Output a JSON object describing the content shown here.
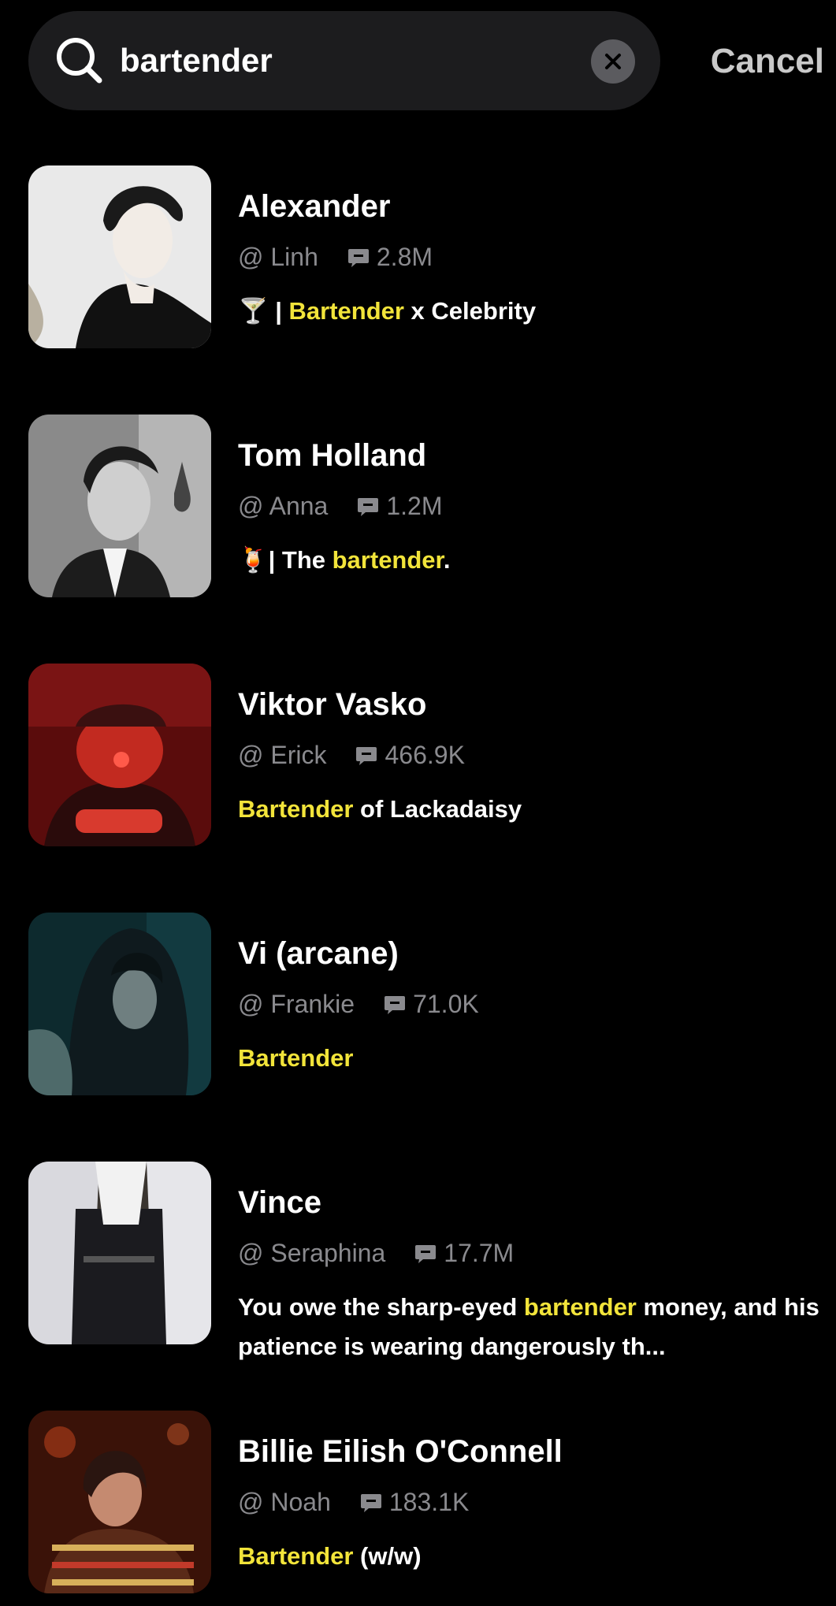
{
  "search": {
    "value": "bartender",
    "cancel_label": "Cancel"
  },
  "results": [
    {
      "name": "Alexander",
      "creator": "@ Linh",
      "count": "2.8M",
      "desc_pre": "🍸 | ",
      "desc_hl": "Bartender",
      "desc_post": " x Celebrity"
    },
    {
      "name": "Tom Holland",
      "creator": "@ Anna",
      "count": "1.2M",
      "desc_pre": "🍹| The ",
      "desc_hl": "bartender",
      "desc_post": "."
    },
    {
      "name": "Viktor Vasko",
      "creator": "@ Erick",
      "count": "466.9K",
      "desc_pre": "",
      "desc_hl": "Bartender",
      "desc_post": " of Lackadaisy"
    },
    {
      "name": "Vi (arcane)",
      "creator": "@ Frankie",
      "count": "71.0K",
      "desc_pre": " ",
      "desc_hl": "Bartender",
      "desc_post": ""
    },
    {
      "name": "Vince",
      "creator": "@ Seraphina",
      "count": "17.7M",
      "desc_pre": "You owe the sharp-eyed ",
      "desc_hl": "bartender",
      "desc_post": " money, and his patience is wearing dangerously th..."
    },
    {
      "name": "Billie Eilish O'Connell",
      "creator": "@ Noah",
      "count": "183.1K",
      "desc_pre": "",
      "desc_hl": "Bartender",
      "desc_post": " (w/w)"
    }
  ],
  "colors": {
    "background": "#000000",
    "highlight": "#f2e43a",
    "muted": "#8a8a8e",
    "searchbox": "#1c1c1e"
  },
  "icons": {
    "search": "search-icon",
    "clear": "close-icon",
    "count": "chat-bubble-icon"
  }
}
